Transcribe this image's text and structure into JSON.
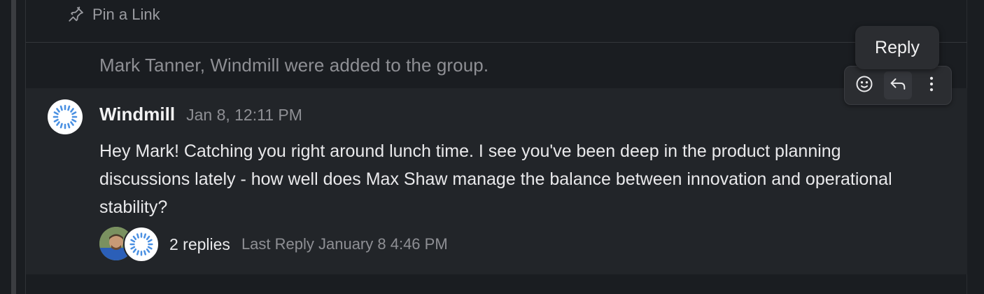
{
  "pin": {
    "label": "Pin a Link",
    "icon": "pin-icon"
  },
  "system_message": "Mark Tanner, Windmill were added to the group.",
  "message": {
    "author": "Windmill",
    "timestamp": "Jan 8, 12:11 PM",
    "body": "Hey Mark! Catching you right around lunch time. I see you've been deep in the product planning discussions lately - how well does Max Shaw manage the balance between innovation and operational stability?",
    "thread": {
      "replies_label": "2 replies",
      "last_reply": "Last Reply January 8 4:46 PM"
    }
  },
  "hover_toolbar": {
    "tooltip": "Reply",
    "actions": [
      "emoji-reaction-icon",
      "reply-icon",
      "more-vertical-icon"
    ]
  },
  "colors": {
    "background": "#1a1d21",
    "message_highlight": "#222529",
    "windmill_logo": "#4a90e2"
  }
}
